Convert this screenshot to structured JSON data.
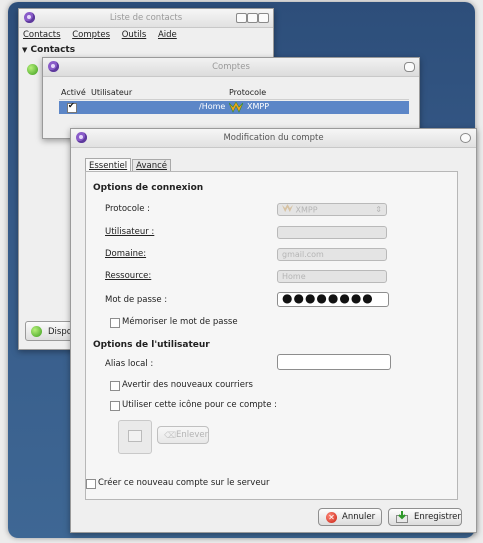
{
  "contacts_window": {
    "title": "Liste de contacts",
    "menu": [
      "Contacts",
      "Comptes",
      "Outils",
      "Aide"
    ],
    "group_label": "Contacts",
    "status_button": "Disponible"
  },
  "accounts_window": {
    "title": "Comptes",
    "columns": [
      "Activé",
      "Utilisateur",
      "Protocole"
    ],
    "row": {
      "user": "/Home",
      "protocol": "XMPP"
    }
  },
  "edit_dialog": {
    "title": "Modification du compte",
    "tabs": [
      "Essentiel",
      "Avancé"
    ],
    "connection_section": "Options de connexion",
    "fields": {
      "protocol_label": "Protocole :",
      "protocol_value": "XMPP",
      "user_label": "Utilisateur :",
      "domain_label": "Domaine:",
      "domain_value": "gmail.com",
      "resource_label": "Ressource:",
      "resource_value": "Home",
      "password_label": "Mot de passe :",
      "password_value": "●●●●●●●●",
      "remember_password": "Mémoriser le mot de passe"
    },
    "user_section": "Options de l'utilisateur",
    "local_alias_label": "Alias local :",
    "new_mail_label": "Avertir des nouveaux courriers",
    "use_icon_label": "Utiliser cette icône pour ce compte :",
    "remove_button": "Enlever",
    "create_on_server": "Créer ce nouveau compte sur le serveur",
    "cancel_button": "Annuler",
    "save_button": "Enregistrer"
  },
  "colors": {
    "selection": "#5c86c7",
    "frame": "#365a88",
    "purple": "#8a5cc9"
  }
}
